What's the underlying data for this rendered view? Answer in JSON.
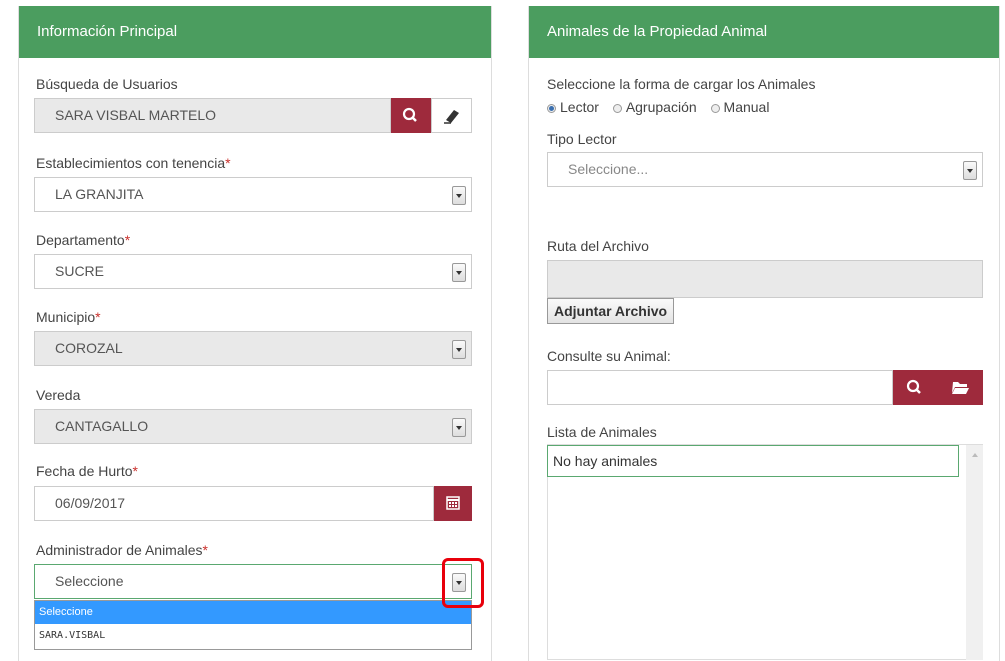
{
  "left_panel": {
    "title": "Información Principal",
    "busqueda": {
      "label": "Búsqueda de Usuarios",
      "value": "SARA VISBAL MARTELO"
    },
    "establecimientos": {
      "label": "Establecimientos con tenencia",
      "value": "LA GRANJITA"
    },
    "departamento": {
      "label": "Departamento",
      "value": "SUCRE"
    },
    "municipio": {
      "label": "Municipio",
      "value": "COROZAL"
    },
    "vereda": {
      "label": "Vereda",
      "value": "CANTAGALLO"
    },
    "fecha": {
      "label": "Fecha de Hurto",
      "value": "06/09/2017"
    },
    "administrador": {
      "label": "Administrador de Animales",
      "value": "Seleccione",
      "options": [
        "Seleccione",
        "SARA.VISBAL"
      ]
    },
    "required_mark": "*"
  },
  "right_panel": {
    "title": "Animales de la Propiedad Animal",
    "carga_label": "Seleccione la forma de cargar los Animales",
    "radio_options": [
      "Lector",
      "Agrupación",
      "Manual"
    ],
    "radio_selected": "Lector",
    "tipo_lector": {
      "label": "Tipo Lector",
      "value": "Seleccione..."
    },
    "ruta": {
      "label": "Ruta del Archivo",
      "value": ""
    },
    "adjuntar_label": "Adjuntar Archivo",
    "consulte": {
      "label": "Consulte su Animal:",
      "value": ""
    },
    "lista": {
      "label": "Lista de Animales",
      "value": "No hay animales"
    }
  },
  "colors": {
    "header_green": "#4b9d5f",
    "button_maroon": "#9e2a3c",
    "highlight_red": "#e8000b",
    "option_blue": "#3399ff"
  }
}
